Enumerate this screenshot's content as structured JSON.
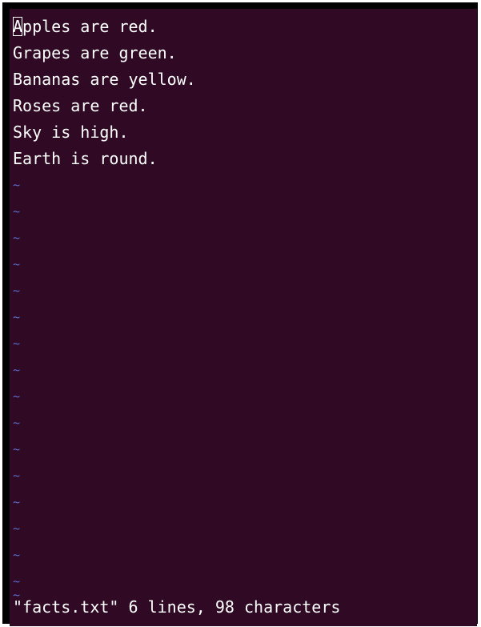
{
  "editor": {
    "cursor_char": "A",
    "lines": [
      "pples are red.",
      "Grapes are green.",
      "Bananas are yellow.",
      "Roses are red.",
      "Sky is high.",
      "Earth is round."
    ],
    "tilde": "~",
    "tilde_count": 17,
    "status": "\"facts.txt\" 6 lines, 98 characters"
  },
  "colors": {
    "background": "#300a24",
    "text": "#ffffff",
    "tilde": "#5b6cc6"
  }
}
